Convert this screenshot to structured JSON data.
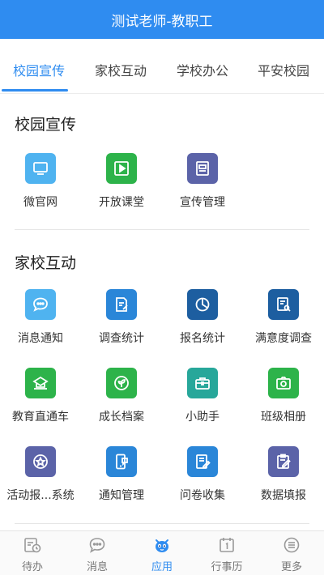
{
  "header": {
    "title": "测试老师-教职工"
  },
  "tabs": [
    {
      "label": "校园宣传",
      "active": true
    },
    {
      "label": "家校互动",
      "active": false
    },
    {
      "label": "学校办公",
      "active": false
    },
    {
      "label": "平安校园",
      "active": false
    }
  ],
  "sections": [
    {
      "title": "校园宣传",
      "items": [
        {
          "label": "微官网",
          "icon": "monitor-icon",
          "color": "#4fb3f0"
        },
        {
          "label": "开放课堂",
          "icon": "video-play-icon",
          "color": "#2db34a"
        },
        {
          "label": "宣传管理",
          "icon": "document-icon",
          "color": "#5b63a8"
        }
      ]
    },
    {
      "title": "家校互动",
      "items": [
        {
          "label": "消息通知",
          "icon": "chat-bubble-icon",
          "color": "#4fb3f0"
        },
        {
          "label": "调查统计",
          "icon": "edit-document-icon",
          "color": "#2a86d8"
        },
        {
          "label": "报名统计",
          "icon": "pie-chart-icon",
          "color": "#1d5ea0"
        },
        {
          "label": "满意度调查",
          "icon": "search-document-icon",
          "color": "#1d5ea0"
        },
        {
          "label": "教育直通车",
          "icon": "school-icon",
          "color": "#2db34a"
        },
        {
          "label": "成长档案",
          "icon": "sprout-icon",
          "color": "#2db34a"
        },
        {
          "label": "小助手",
          "icon": "briefcase-icon",
          "color": "#27a79a"
        },
        {
          "label": "班级相册",
          "icon": "camera-icon",
          "color": "#2db34a"
        },
        {
          "label": "活动报...系统",
          "icon": "star-badge-icon",
          "color": "#5b63a8"
        },
        {
          "label": "通知管理",
          "icon": "phone-chat-icon",
          "color": "#2a86d8"
        },
        {
          "label": "问卷收集",
          "icon": "form-edit-icon",
          "color": "#2a86d8"
        },
        {
          "label": "数据填报",
          "icon": "clipboard-edit-icon",
          "color": "#5b63a8"
        }
      ]
    }
  ],
  "tabbar": [
    {
      "label": "待办",
      "icon": "todo-clock-icon",
      "active": false
    },
    {
      "label": "消息",
      "icon": "message-icon",
      "active": false
    },
    {
      "label": "应用",
      "icon": "app-mascot-icon",
      "active": true
    },
    {
      "label": "行事历",
      "icon": "calendar-icon",
      "active": false
    },
    {
      "label": "更多",
      "icon": "more-menu-icon",
      "active": false
    }
  ],
  "colors": {
    "accent": "#2f8cf0"
  }
}
